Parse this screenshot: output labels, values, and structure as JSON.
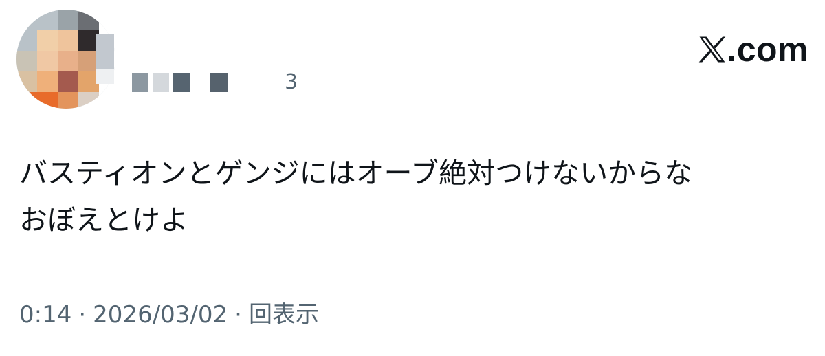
{
  "header": {
    "handle_tail": "3",
    "brand": {
      "domain": ".com"
    }
  },
  "tweet": {
    "lines": [
      "バスティオンとゲンジにはオーブ絶対つけないからな",
      "おぼえとけよ"
    ]
  },
  "meta": {
    "time": "0:14",
    "separator": "·",
    "date": "2026/03/02",
    "views": "回表示"
  },
  "colors": {
    "text_primary": "#0f1419",
    "text_secondary": "#536471",
    "background": "#ffffff"
  },
  "icons": {
    "avatar": "avatar-pixelated",
    "brand": "x-logo-icon"
  }
}
